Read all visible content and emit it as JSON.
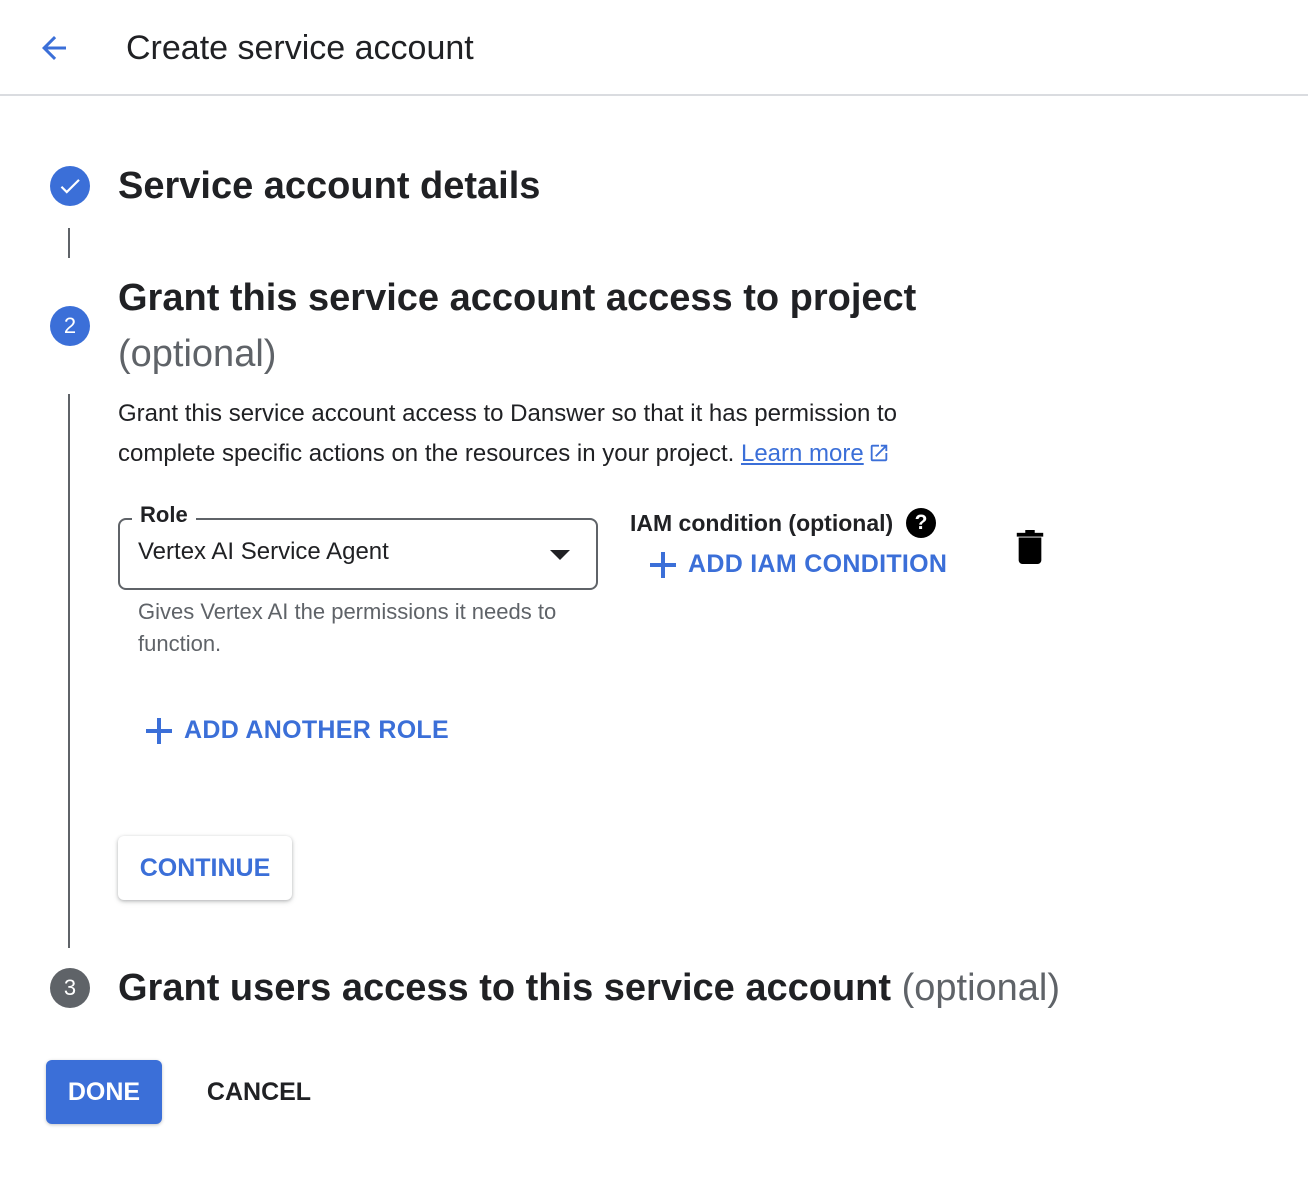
{
  "header": {
    "title": "Create service account",
    "back_icon": "arrow-back-icon"
  },
  "steps": {
    "step1": {
      "title": "Service account details",
      "status": "completed",
      "icon": "check-icon"
    },
    "step2": {
      "number": "2",
      "title": "Grant this service account access to project",
      "optional": "(optional)",
      "description": "Grant this service account access to Danswer so that it has permission to complete specific actions on the resources in your project.",
      "learn_more": "Learn more",
      "role": {
        "label": "Role",
        "value": "Vertex AI Service Agent",
        "help": "Gives Vertex AI the permissions it needs to function."
      },
      "iam": {
        "label": "IAM condition (optional)",
        "help_icon": "?",
        "add_condition": "ADD IAM CONDITION"
      },
      "add_another_role": "ADD ANOTHER ROLE",
      "continue_label": "CONTINUE"
    },
    "step3": {
      "number": "3",
      "title": "Grant users access to this service account",
      "optional": "(optional)"
    }
  },
  "footer": {
    "done_label": "DONE",
    "cancel_label": "CANCEL"
  },
  "colors": {
    "accent": "#3b6fd8",
    "inactive": "#5f6368",
    "text": "#202124"
  }
}
